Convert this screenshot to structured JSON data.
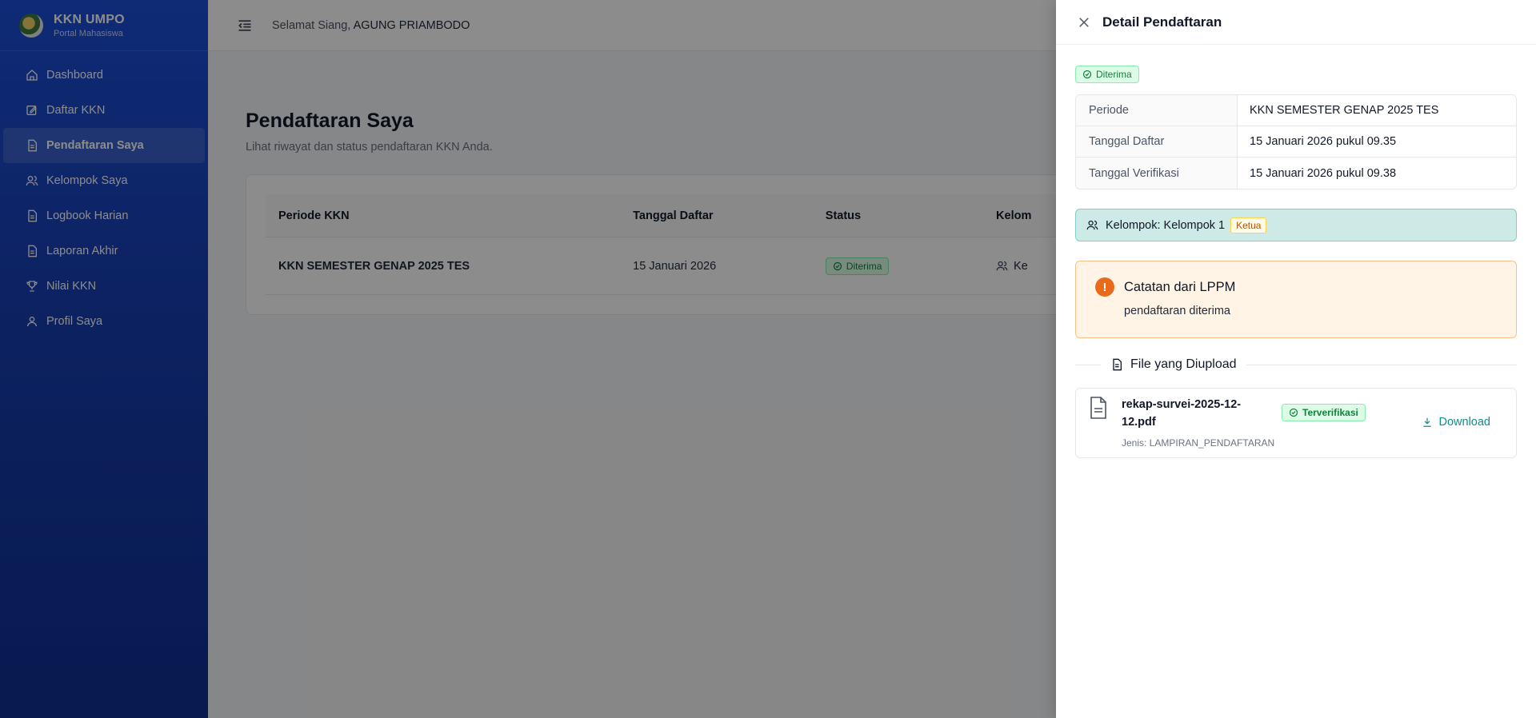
{
  "sidebar": {
    "brand_title": "KKN UMPO",
    "brand_subtitle": "Portal Mahasiswa",
    "items": [
      {
        "label": "Dashboard",
        "icon": "home-icon"
      },
      {
        "label": "Daftar KKN",
        "icon": "edit-icon"
      },
      {
        "label": "Pendaftaran Saya",
        "icon": "document-icon",
        "active": true
      },
      {
        "label": "Kelompok Saya",
        "icon": "users-icon"
      },
      {
        "label": "Logbook Harian",
        "icon": "document-icon"
      },
      {
        "label": "Laporan Akhir",
        "icon": "document-icon"
      },
      {
        "label": "Nilai KKN",
        "icon": "trophy-icon"
      },
      {
        "label": "Profil Saya",
        "icon": "user-icon"
      }
    ]
  },
  "topbar": {
    "greeting": "Selamat Siang,",
    "user_name": "AGUNG PRIAMBODO"
  },
  "main": {
    "title": "Pendaftaran Saya",
    "subtitle": "Lihat riwayat dan status pendaftaran KKN Anda.",
    "table": {
      "headers": [
        "Periode KKN",
        "Tanggal Daftar",
        "Status",
        "Kelom"
      ],
      "rows": [
        {
          "periode": "KKN SEMESTER GENAP 2025 TES",
          "tanggal": "15 Januari 2026",
          "status": "Diterima",
          "kelompok": "Ke"
        }
      ]
    }
  },
  "drawer": {
    "title": "Detail Pendaftaran",
    "status_badge": "Diterima",
    "details": [
      {
        "key": "Periode",
        "value": "KKN SEMESTER GENAP 2025 TES"
      },
      {
        "key": "Tanggal Daftar",
        "value": "15 Januari 2026 pukul 09.35"
      },
      {
        "key": "Tanggal Verifikasi",
        "value": "15 Januari 2026 pukul 09.38"
      }
    ],
    "group_label": "Kelompok: Kelompok 1",
    "group_role": "Ketua",
    "note_title": "Catatan dari LPPM",
    "note_text": "pendaftaran diterima",
    "files_heading": "File yang Diupload",
    "file": {
      "name": "rekap-survei-2025-12-12.pdf",
      "type": "Jenis: LAMPIRAN_PENDAFTARAN",
      "badge": "Terverifikasi",
      "download_label": "Download"
    }
  },
  "colors": {
    "sidebar_top": "#1d4fd8",
    "sidebar_bottom": "#0f2f8f",
    "success": "#15803d",
    "accent_teal": "#0e8f8c",
    "warning": "#ea6a1c"
  }
}
